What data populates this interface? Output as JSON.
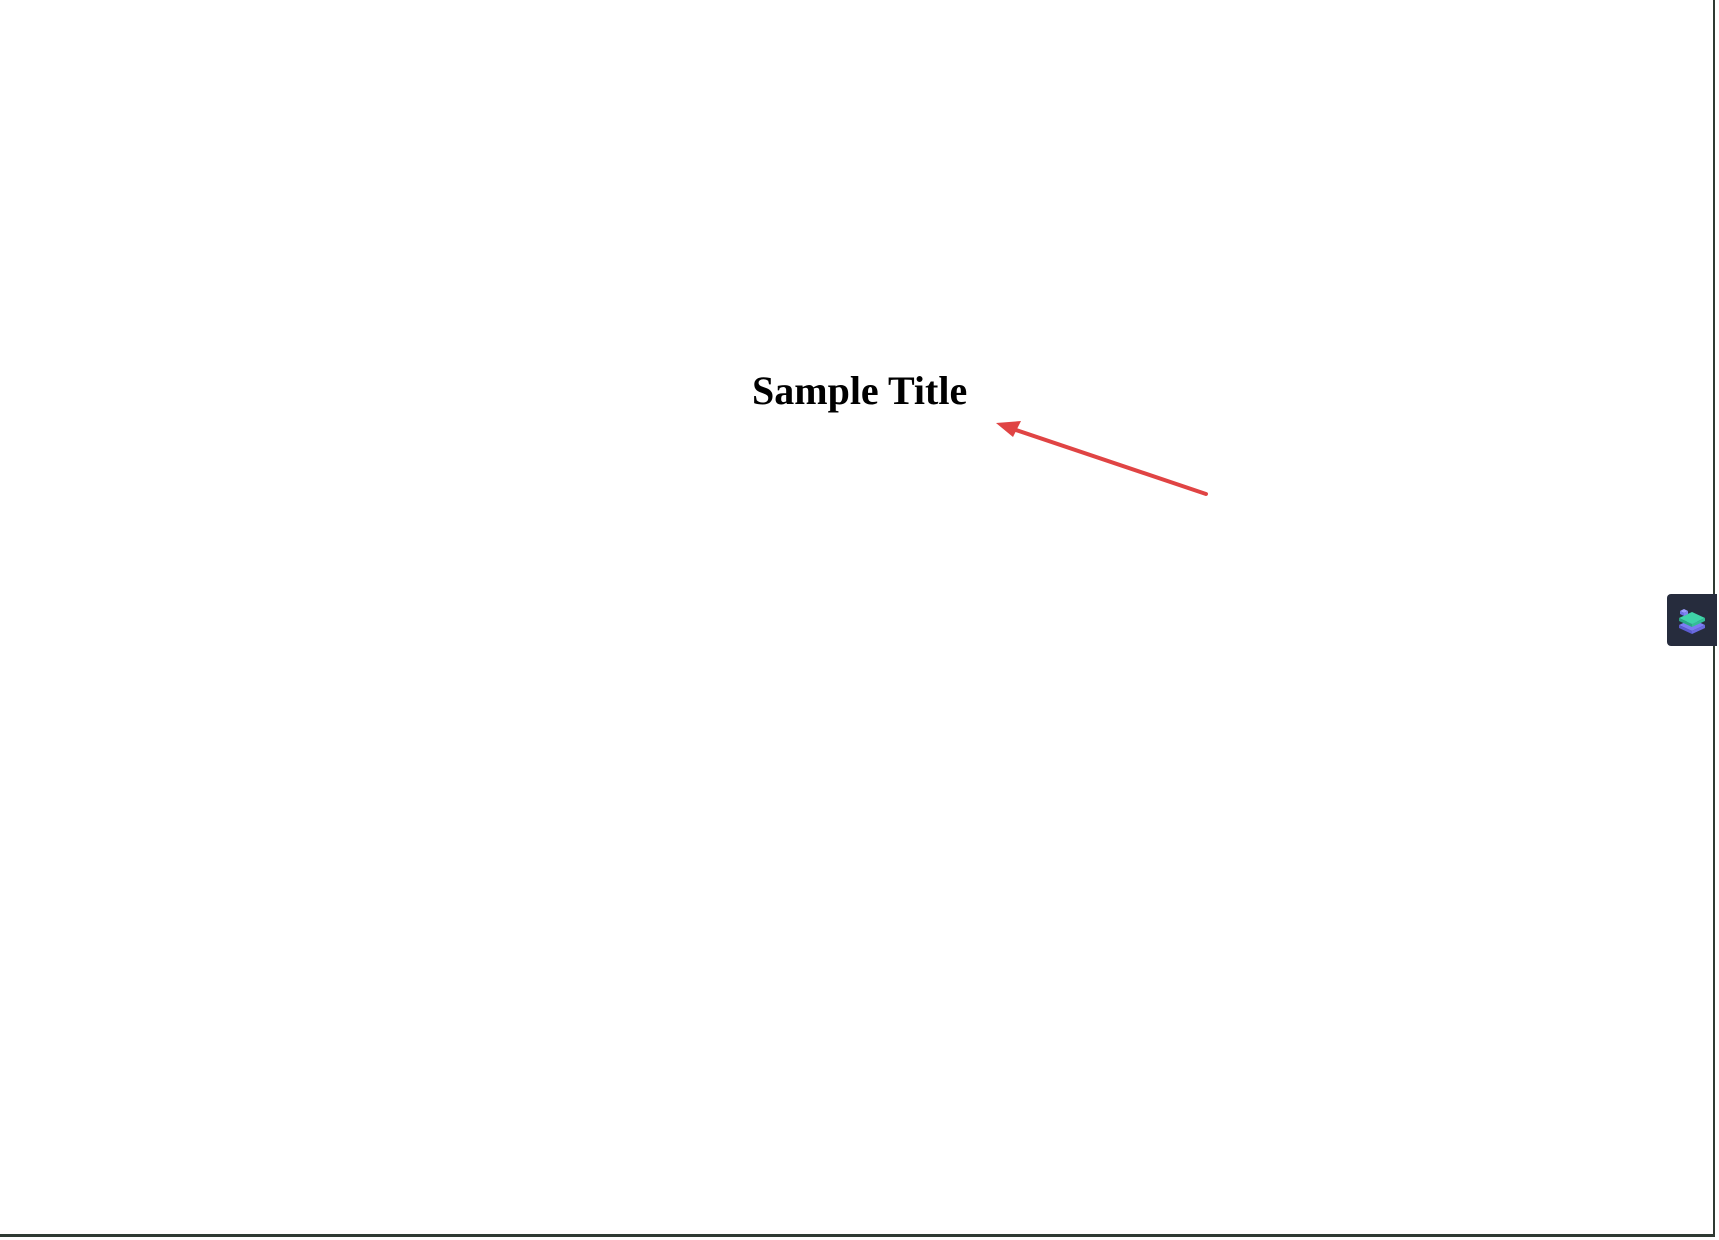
{
  "page": {
    "title": "Sample Title"
  },
  "annotation": {
    "arrow_color": "#e04444",
    "arrow_icon": "arrow-icon"
  },
  "side_widget": {
    "icon": "stacked-layers-icon",
    "background_color": "#262c3d",
    "layer_colors": [
      "#3fd3a8",
      "#7b7cf3"
    ]
  }
}
